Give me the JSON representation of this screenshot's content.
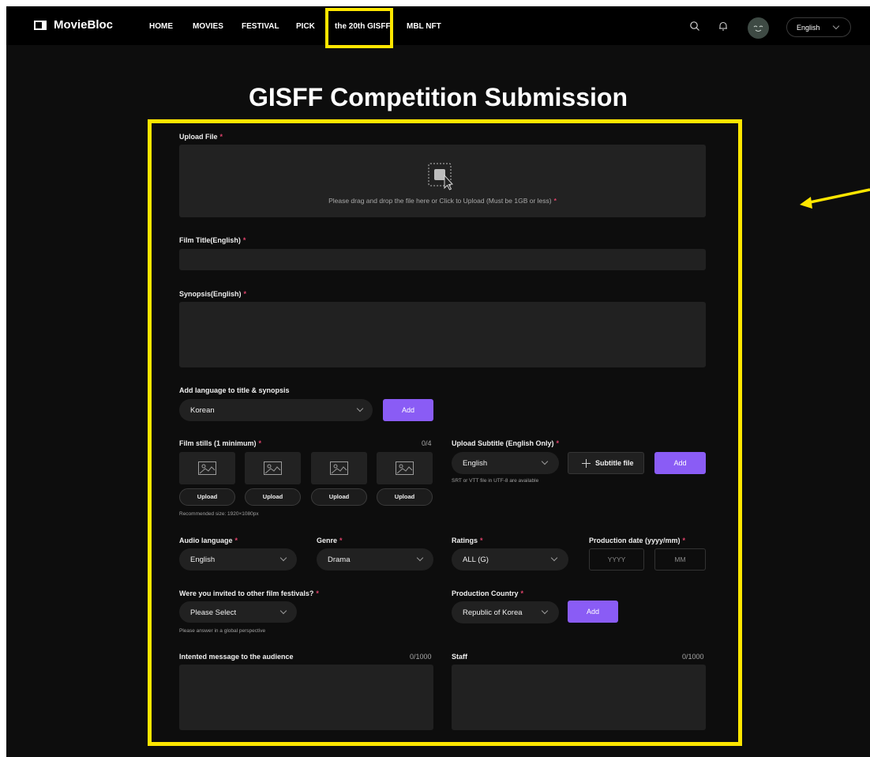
{
  "nav": {
    "logo": "MovieBloc",
    "links": [
      "HOME",
      "MOVIES",
      "FESTIVAL",
      "PICK",
      "the 20th GISFF",
      "MBL NFT"
    ],
    "language": "English",
    "icons": [
      "search-icon",
      "bell-icon",
      "avatar",
      "chevron-down-icon"
    ]
  },
  "page_title": "GISFF Competition Submission",
  "form": {
    "upload_file": {
      "label": "Upload File",
      "hint": "Please drag and drop the file here or Click to Upload (Must be 1GB or less)"
    },
    "film_title": {
      "label": "Film Title(English)",
      "value": ""
    },
    "synopsis": {
      "label": "Synopsis(English)",
      "value": ""
    },
    "add_language": {
      "label": "Add language to title & synopsis",
      "selected": "Korean",
      "add_label": "Add"
    },
    "film_stills": {
      "label": "Film stills (1 minimum)",
      "count": "0/4",
      "upload_label": "Upload",
      "recommended": "Recommended size: 1920×1080px"
    },
    "subtitle": {
      "label": "Upload Subtitle (English Only)",
      "selected": "English",
      "file_label": "Subtitle file",
      "add_label": "Add",
      "hint": "SRT or VTT file in UTF-8 are available"
    },
    "audio_language": {
      "label": "Audio language",
      "selected": "English"
    },
    "genre": {
      "label": "Genre",
      "selected": "Drama"
    },
    "ratings": {
      "label": "Ratings",
      "selected": "ALL (G)"
    },
    "production_date": {
      "label": "Production date (yyyy/mm)",
      "year_placeholder": "YYYY",
      "month_placeholder": "MM"
    },
    "invited": {
      "label": "Were you invited to other film festivals?",
      "selected": "Please Select",
      "hint": "Please answer in a global perspective"
    },
    "production_country": {
      "label": "Production Country",
      "selected": "Republic of Korea",
      "add_label": "Add"
    },
    "message": {
      "label": "Intented message to the audience",
      "count": "0/1000"
    },
    "staff": {
      "label": "Staff",
      "count": "0/1000"
    },
    "required_mark": "*"
  },
  "colors": {
    "accent": "#8a5cf5",
    "highlight": "#ffe600",
    "required": "#e0436b"
  }
}
